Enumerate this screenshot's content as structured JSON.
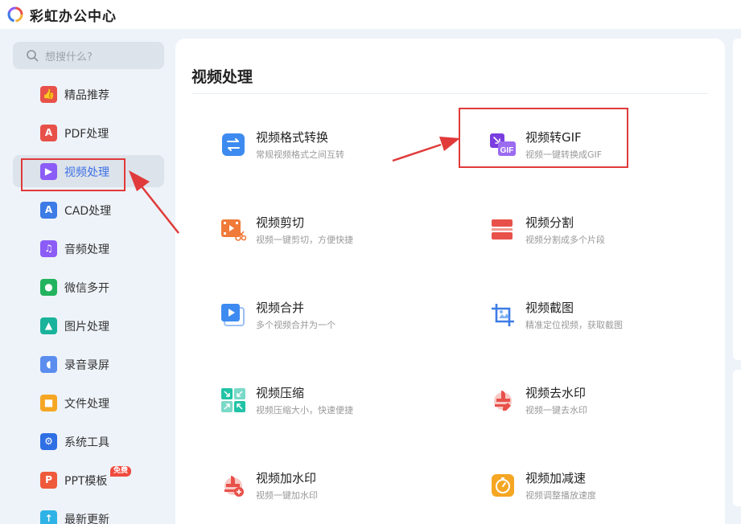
{
  "app": {
    "title": "彩虹办公中心"
  },
  "search": {
    "placeholder": "想搜什么?"
  },
  "sidebar": {
    "items": [
      {
        "label": "精品推荐",
        "icon": "thumbs-up-icon",
        "color": "#e8514a"
      },
      {
        "label": "PDF处理",
        "icon": "pdf-icon",
        "color": "#e8514a"
      },
      {
        "label": "视频处理",
        "icon": "play-icon",
        "color": "#8b5cf6",
        "active": true
      },
      {
        "label": "CAD处理",
        "icon": "cad-icon",
        "color": "#3d7be6"
      },
      {
        "label": "音频处理",
        "icon": "music-icon",
        "color": "#8b5cf6"
      },
      {
        "label": "微信多开",
        "icon": "wechat-icon",
        "color": "#22b35e"
      },
      {
        "label": "图片处理",
        "icon": "image-icon",
        "color": "#19b39b"
      },
      {
        "label": "录音录屏",
        "icon": "microphone-icon",
        "color": "#5b8def"
      },
      {
        "label": "文件处理",
        "icon": "folder-icon",
        "color": "#f5a623"
      },
      {
        "label": "系统工具",
        "icon": "gear-icon",
        "color": "#2f6fe4"
      },
      {
        "label": "PPT模板",
        "icon": "ppt-icon",
        "color": "#ef5a3a",
        "badge": "免费"
      },
      {
        "label": "最新更新",
        "icon": "upload-icon",
        "color": "#2fb3e6"
      }
    ]
  },
  "main": {
    "section_title": "视频处理",
    "tools": [
      {
        "name": "视频格式转换",
        "desc": "常规视频格式之间互转",
        "icon": "swap-icon"
      },
      {
        "name": "视频转GIF",
        "desc": "视频一键转换成GIF",
        "icon": "gif-icon"
      },
      {
        "name": "视频剪切",
        "desc": "视频一键剪切，方便快捷",
        "icon": "cut-icon"
      },
      {
        "name": "视频分割",
        "desc": "视频分割成多个片段",
        "icon": "split-icon"
      },
      {
        "name": "视频合并",
        "desc": "多个视频合并为一个",
        "icon": "merge-icon"
      },
      {
        "name": "视频截图",
        "desc": "精准定位视频，获取截图",
        "icon": "crop-icon"
      },
      {
        "name": "视频压缩",
        "desc": "视频压缩大小，快速便捷",
        "icon": "compress-icon"
      },
      {
        "name": "视频去水印",
        "desc": "视频一键去水印",
        "icon": "remove-watermark-icon"
      },
      {
        "name": "视频加水印",
        "desc": "视频一键加水印",
        "icon": "add-watermark-icon"
      },
      {
        "name": "视频加减速",
        "desc": "视频调整播放速度",
        "icon": "speed-icon"
      }
    ]
  },
  "colors": {
    "accent": "#3d6fe6",
    "highlight": "#e03a3a"
  }
}
